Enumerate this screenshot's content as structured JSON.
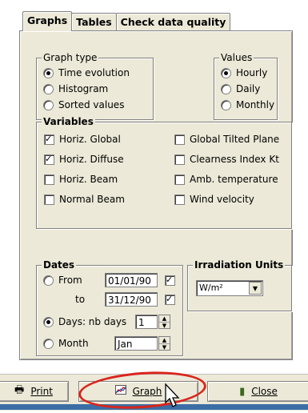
{
  "tabs": [
    {
      "label": "Graphs",
      "active": true
    },
    {
      "label": "Tables",
      "active": false
    },
    {
      "label": "Check data quality",
      "active": false
    }
  ],
  "graph_type": {
    "legend": "Graph type",
    "options": [
      {
        "label": "Time evolution",
        "selected": true
      },
      {
        "label": "Histogram",
        "selected": false
      },
      {
        "label": "Sorted values",
        "selected": false
      }
    ]
  },
  "values": {
    "legend": "Values",
    "options": [
      {
        "label": "Hourly",
        "selected": true
      },
      {
        "label": "Daily",
        "selected": false
      },
      {
        "label": "Monthly",
        "selected": false
      }
    ]
  },
  "variables": {
    "legend": "Variables",
    "left": [
      {
        "label": "Horiz. Global",
        "checked": true
      },
      {
        "label": "Horiz. Diffuse",
        "checked": true
      },
      {
        "label": "Horiz. Beam",
        "checked": false
      },
      {
        "label": "Normal Beam",
        "checked": false
      }
    ],
    "right": [
      {
        "label": "Global Tilted Plane",
        "checked": false
      },
      {
        "label": "Clearness Index Kt",
        "checked": false
      },
      {
        "label": "Amb. temperature",
        "checked": false
      },
      {
        "label": "Wind velocity",
        "checked": false
      }
    ]
  },
  "dates": {
    "legend": "Dates",
    "from_label": "From",
    "from_value": "01/01/90",
    "to_label": "to",
    "to_value": "31/12/90",
    "days_label": "Days: nb days",
    "days_value": "1",
    "month_label": "Month",
    "month_value": "Jan",
    "selected": "days"
  },
  "irradiation": {
    "legend": "Irradiation Units",
    "value": "W/m²"
  },
  "buttons": {
    "print": "Print",
    "graph": "Graph",
    "close": "Close"
  },
  "colors": {
    "highlight": "#d9251c",
    "taskbar": "#3a6ea5"
  }
}
